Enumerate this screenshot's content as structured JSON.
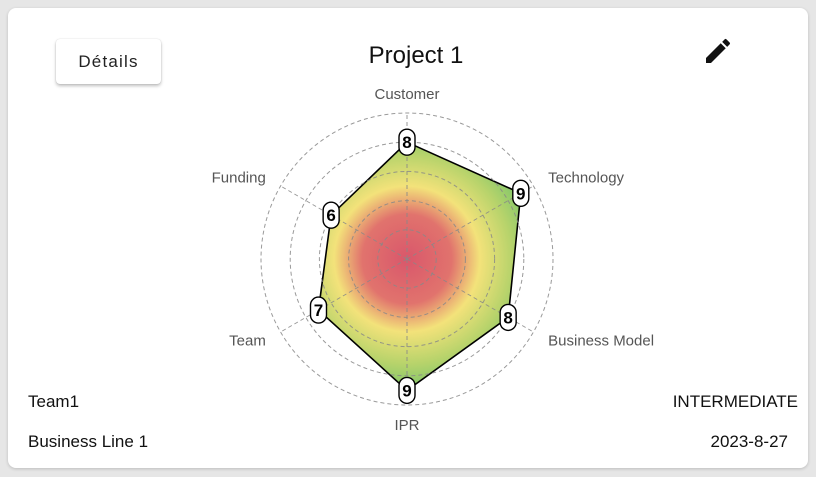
{
  "card": {
    "details_label": "Détails",
    "title": "Project 1",
    "edit_icon": "pencil-icon",
    "team": "Team1",
    "business_line": "Business Line 1",
    "level": "INTERMEDIATE",
    "date": "2023-8-27"
  },
  "chart_data": {
    "type": "radar",
    "axes": [
      "Customer",
      "Technology",
      "Business Model",
      "IPR",
      "Team",
      "Funding"
    ],
    "values": [
      8,
      9,
      8,
      9,
      7,
      6
    ],
    "range": [
      0,
      10
    ],
    "grid": "dashed concentric circles",
    "colors": {
      "outline": "#000000",
      "gradient_center": "#d9576b",
      "gradient_mid": "#f3e27a",
      "gradient_outer": "#6cc26a"
    }
  }
}
